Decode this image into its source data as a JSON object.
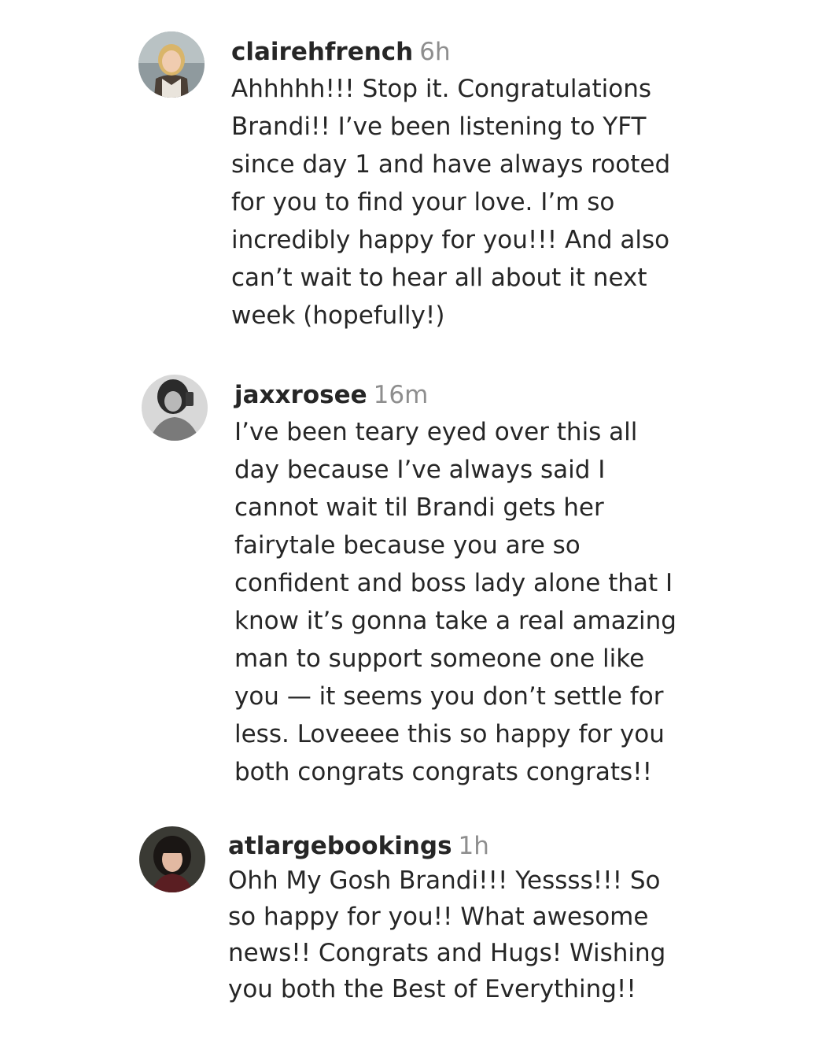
{
  "comments": [
    {
      "username": "clairehfrench",
      "time": "6h",
      "lines": [
        "Ahhhhh!!! Stop it. Congratulations",
        "Brandi!! I’ve been listening to YFT",
        "since day 1 and have always rooted",
        "for you to find your love. I’m so",
        "incredibly happy for you!!! And also",
        "can’t wait to hear all about it next",
        "week (hopefully!)"
      ]
    },
    {
      "username": "jaxxrosee",
      "time": "16m",
      "lines": [
        "I’ve been teary eyed over this all",
        "day because I’ve always said I",
        "cannot wait til Brandi gets her",
        "fairytale because you are so",
        "confident and boss lady alone that I",
        "know it’s gonna take a real amazing",
        "man to support someone one like",
        "you — it seems you don’t settle for",
        "less. Loveeee this so happy for you",
        "both congrats congrats congrats!!"
      ]
    },
    {
      "username": "atlargebookings",
      "time": "1h",
      "lines": [
        "Ohh My Gosh Brandi!!! Yessss!!! So",
        "so happy for you!! What awesome",
        "news!! Congrats and Hugs! Wishing",
        "you both the Best of Everything!!"
      ]
    }
  ]
}
